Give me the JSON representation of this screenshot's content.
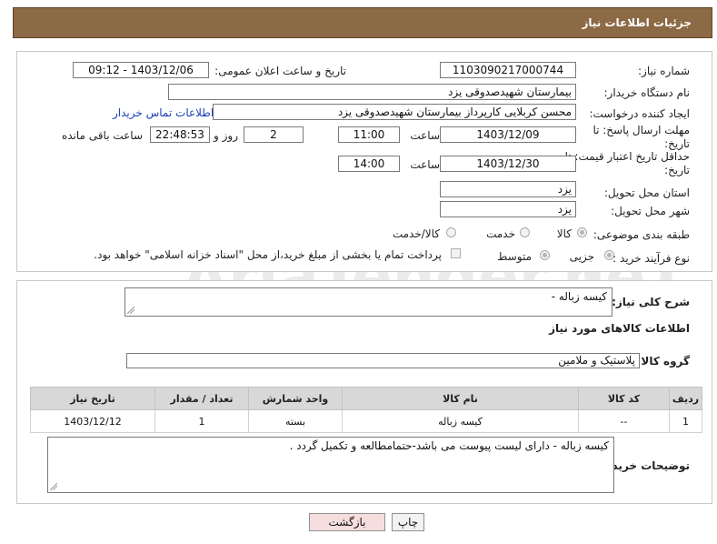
{
  "header": {
    "title": "جزئیات اطلاعات نیاز"
  },
  "labels": {
    "need_number": "شماره نیاز:",
    "announce_datetime": "تاریخ و ساعت اعلان عمومی:",
    "buyer_org": "نام دستگاه خریدار:",
    "requester": "ایجاد کننده درخواست:",
    "contact_link": "اطلاعات تماس خریدار",
    "reply_deadline": "مهلت ارسال پاسخ: تا تاریخ:",
    "time": "ساعت",
    "days_and": "روز و",
    "hours_remaining": "ساعت باقی مانده",
    "price_validity": "حداقل تاریخ اعتبار قیمت: تا تاریخ:",
    "delivery_province": "استان محل تحویل:",
    "delivery_city": "شهر محل تحویل:",
    "category": "طبقه بندی موضوعی:",
    "purchase_type": "نوع فرآیند خرید :",
    "general_desc": "شرح کلی نیاز:",
    "goods_info": "اطلاعات کالاهای مورد نیاز",
    "goods_group": "گروه کالا:",
    "buyer_notes": "توضیحات خریدار:"
  },
  "values": {
    "need_number": "1103090217000744",
    "announce_datetime": "1403/12/06 - 09:12",
    "buyer_org": "بیمارستان شهیدصدوقی یزد",
    "requester": "محسن کربلایی کارپرداز بیمارستان شهیدصدوقی یزد",
    "reply_date": "1403/12/09",
    "reply_time": "11:00",
    "days": "2",
    "remaining_time": "22:48:53",
    "validity_date": "1403/12/30",
    "validity_time": "14:00",
    "province": "یزد",
    "city": "یزد",
    "general_desc": "کیسه زباله -",
    "goods_group": "پلاستیک و ملامین",
    "buyer_notes": "کیسه زباله - دارای لیست پیوست می باشد-حتمامطالعه و تکمیل گردد ."
  },
  "category_options": [
    "کالا",
    "خدمت",
    "کالا/خدمت"
  ],
  "purchase_options": [
    "جزیی",
    "متوسط"
  ],
  "payment_note": "پرداخت تمام یا بخشی از مبلغ خرید،از محل \"اسناد خزانه اسلامی\" خواهد بود.",
  "table": {
    "headers": [
      "ردیف",
      "کد کالا",
      "نام کالا",
      "واحد شمارش",
      "تعداد / مقدار",
      "تاریخ نیاز"
    ],
    "rows": [
      [
        "1",
        "--",
        "کیسه زباله",
        "بسته",
        "1",
        "1403/12/12"
      ]
    ]
  },
  "buttons": {
    "back": "بازگشت",
    "print": "چاپ"
  },
  "watermark_text": "AriaTender.neT",
  "colors": {
    "header_bg": "#8c6a45",
    "link": "#1a3fb8",
    "back_btn_bg": "#f6dede"
  }
}
